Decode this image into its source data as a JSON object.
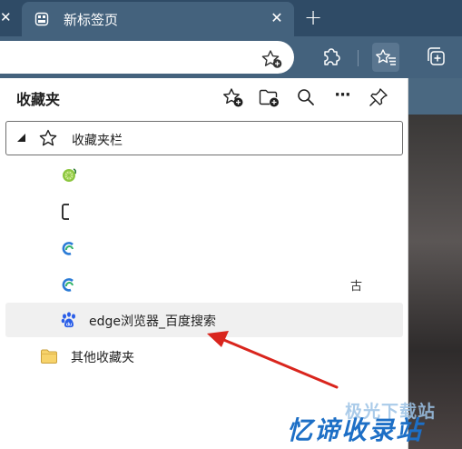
{
  "browser": {
    "tab": {
      "title": "新标签页",
      "close_glyph": "✕",
      "prev_close_glyph": "✕"
    },
    "new_tab_glyph": "+",
    "toolbar": {
      "icons": [
        "star-add-icon",
        "extensions-icon",
        "favorites-icon",
        "collections-icon"
      ]
    }
  },
  "favorites_panel": {
    "title": "收藏夹",
    "actions": [
      "add-favorite-icon",
      "add-folder-icon",
      "search-icon",
      "more-icon",
      "pin-icon"
    ],
    "more_glyph": "···",
    "bar_folder": {
      "label": "收藏夹栏"
    },
    "items": [
      {
        "label": "",
        "icon": "lime-icon"
      },
      {
        "label": "",
        "icon": "page-icon"
      },
      {
        "label": "",
        "icon": "edge-icon"
      },
      {
        "label": "",
        "icon": "edge-icon",
        "trailing": "古"
      },
      {
        "label": "edge浏览器_百度搜索",
        "icon": "baidu-paw-icon"
      }
    ],
    "other_folder": {
      "label": "其他收藏夹"
    }
  },
  "watermark": {
    "top": "极光下载站",
    "main": "忆谛收录站"
  },
  "colors": {
    "chrome_dark": "#2f4b66",
    "chrome": "#44627d",
    "arrow": "#d9251d"
  }
}
